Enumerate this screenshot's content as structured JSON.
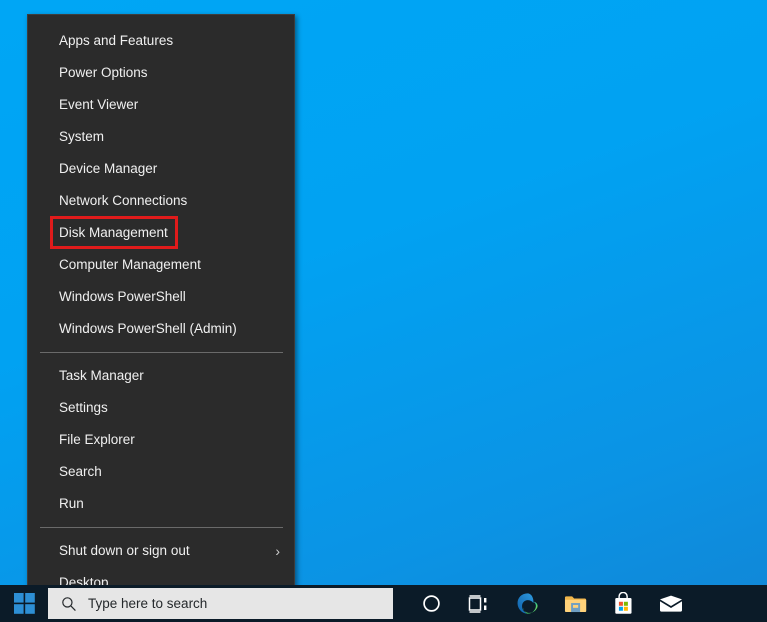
{
  "desktop": {
    "wallpaper_color_top": "#00a6f5",
    "wallpaper_color_bottom": "#1186d6"
  },
  "winx_menu": {
    "name": "Power User Menu",
    "groups": [
      {
        "items": [
          {
            "label": "Apps and Features",
            "icon": "",
            "submenu": false
          },
          {
            "label": "Power Options",
            "icon": "",
            "submenu": false
          },
          {
            "label": "Event Viewer",
            "icon": "",
            "submenu": false
          },
          {
            "label": "System",
            "icon": "",
            "submenu": false
          },
          {
            "label": "Device Manager",
            "icon": "",
            "submenu": false
          },
          {
            "label": "Network Connections",
            "icon": "",
            "submenu": false
          },
          {
            "label": "Disk Management",
            "icon": "",
            "submenu": false,
            "highlighted": true
          },
          {
            "label": "Computer Management",
            "icon": "",
            "submenu": false
          },
          {
            "label": "Windows PowerShell",
            "icon": "",
            "submenu": false
          },
          {
            "label": "Windows PowerShell (Admin)",
            "icon": "",
            "submenu": false
          }
        ]
      },
      {
        "items": [
          {
            "label": "Task Manager",
            "icon": "",
            "submenu": false
          },
          {
            "label": "Settings",
            "icon": "",
            "submenu": false
          },
          {
            "label": "File Explorer",
            "icon": "",
            "submenu": false
          },
          {
            "label": "Search",
            "icon": "",
            "submenu": false
          },
          {
            "label": "Run",
            "icon": "",
            "submenu": false
          }
        ]
      },
      {
        "items": [
          {
            "label": "Shut down or sign out",
            "icon": "chevron-right-icon",
            "submenu": true
          },
          {
            "label": "Desktop",
            "icon": "",
            "submenu": false
          }
        ]
      }
    ],
    "highlight": {
      "target_label": "Disk Management",
      "color": "#e01b1b"
    }
  },
  "taskbar": {
    "start_button": {
      "name": "start-button",
      "icon": "windows-logo-icon",
      "color": "#2a8dd4"
    },
    "search": {
      "placeholder": "Type here to search",
      "icon": "search-icon",
      "value": ""
    },
    "tray_icons": [
      {
        "name": "cortana-icon",
        "label": "Cortana"
      },
      {
        "name": "task-view-icon",
        "label": "Task View"
      },
      {
        "name": "edge-icon",
        "label": "Microsoft Edge"
      },
      {
        "name": "file-explorer-icon",
        "label": "File Explorer"
      },
      {
        "name": "microsoft-store-icon",
        "label": "Microsoft Store"
      },
      {
        "name": "mail-icon",
        "label": "Mail"
      }
    ]
  }
}
